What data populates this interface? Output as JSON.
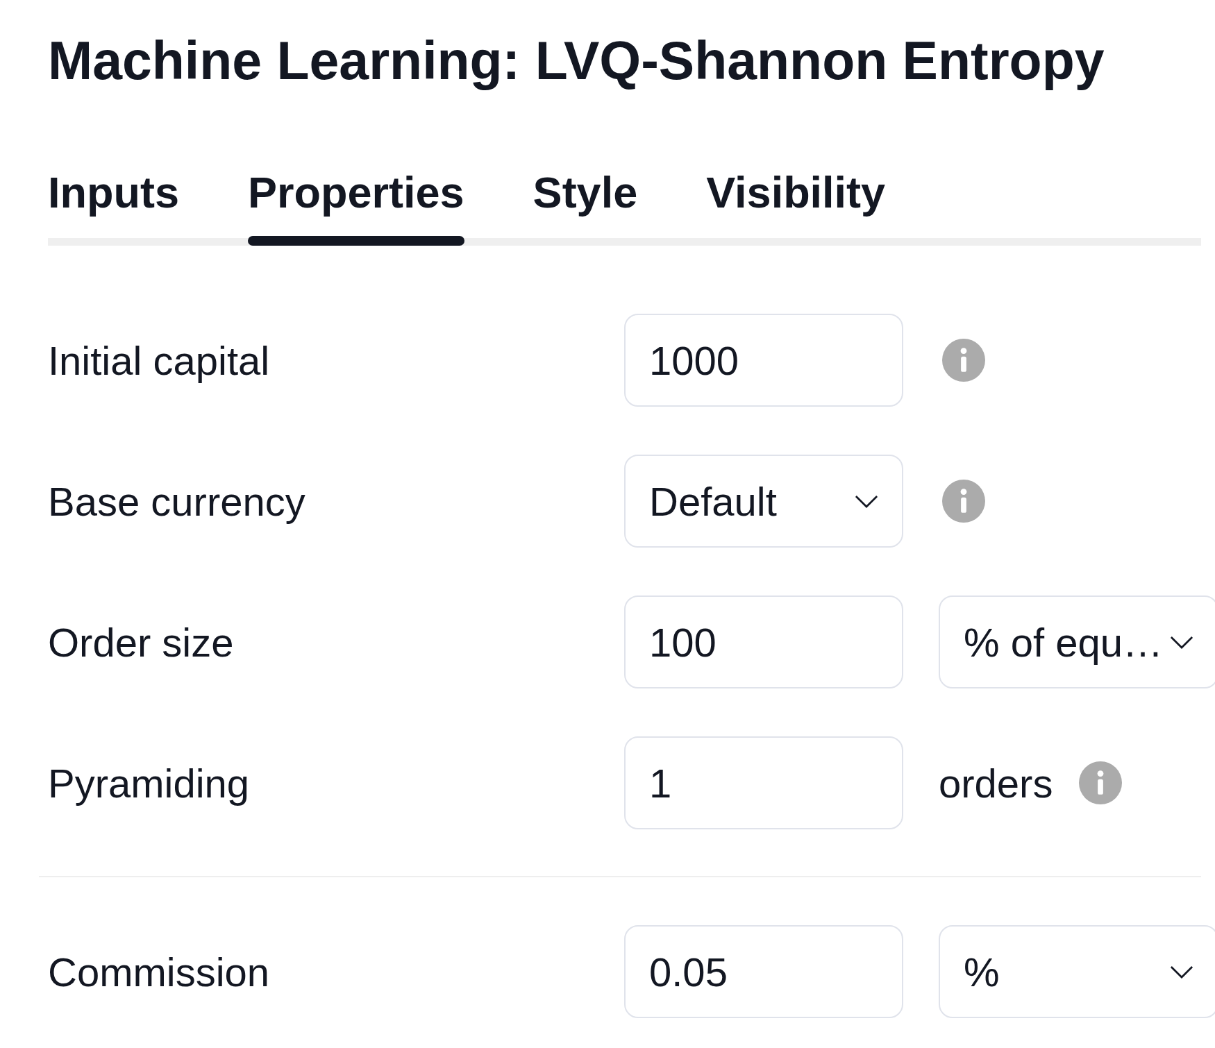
{
  "dialog": {
    "title": "Machine Learning: LVQ-Shannon Entropy"
  },
  "tabs": [
    {
      "label": "Inputs",
      "selected": false
    },
    {
      "label": "Properties",
      "selected": true
    },
    {
      "label": "Style",
      "selected": false
    },
    {
      "label": "Visibility",
      "selected": false
    }
  ],
  "sections": [
    {
      "fields": [
        {
          "label": "Initial capital",
          "control": {
            "kind": "input",
            "value": "1000"
          },
          "after": [
            {
              "kind": "info"
            }
          ]
        },
        {
          "label": "Base currency",
          "control": {
            "kind": "select",
            "value": "Default"
          },
          "after": [
            {
              "kind": "info"
            }
          ]
        },
        {
          "label": "Order size",
          "control": {
            "kind": "input",
            "value": "100"
          },
          "after": [
            {
              "kind": "select",
              "value": "% of equ…"
            }
          ]
        },
        {
          "label": "Pyramiding",
          "control": {
            "kind": "input",
            "value": "1"
          },
          "after": [
            {
              "kind": "unit",
              "text": "orders"
            },
            {
              "kind": "info"
            }
          ]
        }
      ]
    },
    {
      "fields": [
        {
          "label": "Commission",
          "control": {
            "kind": "input",
            "value": "0.05"
          },
          "after": [
            {
              "kind": "select",
              "value": "%"
            }
          ]
        }
      ]
    }
  ]
}
